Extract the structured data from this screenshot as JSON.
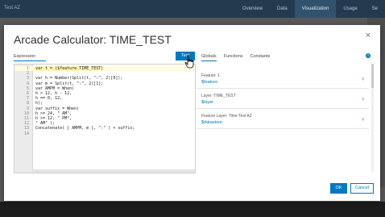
{
  "background": {
    "app_title": "Test AZ",
    "nav": [
      "Overview",
      "Data",
      "Visualization",
      "Usage",
      "Se"
    ],
    "active_nav": "Visualization"
  },
  "dialog": {
    "title": "Arcade Calculator: TIME_TEST",
    "close_label": "×",
    "expression_tab": "Expression",
    "test_button": "Test",
    "tabs": [
      "Globals",
      "Functions",
      "Constants"
    ],
    "active_tab": "Globals",
    "info_label": "i",
    "code_lines": [
      {
        "n": "1",
        "text": "var t = ($feature.TIME_TEST)"
      },
      {
        "n": "2",
        "text": ""
      },
      {
        "n": "3",
        "text": "var h = Number(Split(t, \":\", 2)[0]);"
      },
      {
        "n": "4",
        "text": "var m = Split(t, \":\", 2)[1];"
      },
      {
        "n": "5",
        "text": "var AMPM = When("
      },
      {
        "n": "6",
        "text": "h > 12, h - 12,"
      },
      {
        "n": "7",
        "text": "h == 0, 12,"
      },
      {
        "n": "8",
        "text": "h);"
      },
      {
        "n": "9",
        "text": "var suffix = When("
      },
      {
        "n": "10",
        "text": "h >= 24, \" AM\","
      },
      {
        "n": "11",
        "text": "h >= 12, \" PM\","
      },
      {
        "n": "12",
        "text": "\" AM\" );"
      },
      {
        "n": "13",
        "text": "Concatenate( [ AMPM, m ], \":\" ) + suffix;"
      },
      {
        "n": "14",
        "text": ""
      }
    ],
    "globals": [
      {
        "label": "Feature: 1",
        "value": "$feature"
      },
      {
        "label": "Layer: TIME_TEST",
        "value": "$layer"
      },
      {
        "label": "Feature Layer: Time Test AZ",
        "value": "$datastore"
      }
    ],
    "ok_button": "OK",
    "cancel_button": "Cancel"
  },
  "colors": {
    "accent": "#0079c1",
    "header": "#243a4e",
    "highlight_line": "#fff3b8"
  }
}
